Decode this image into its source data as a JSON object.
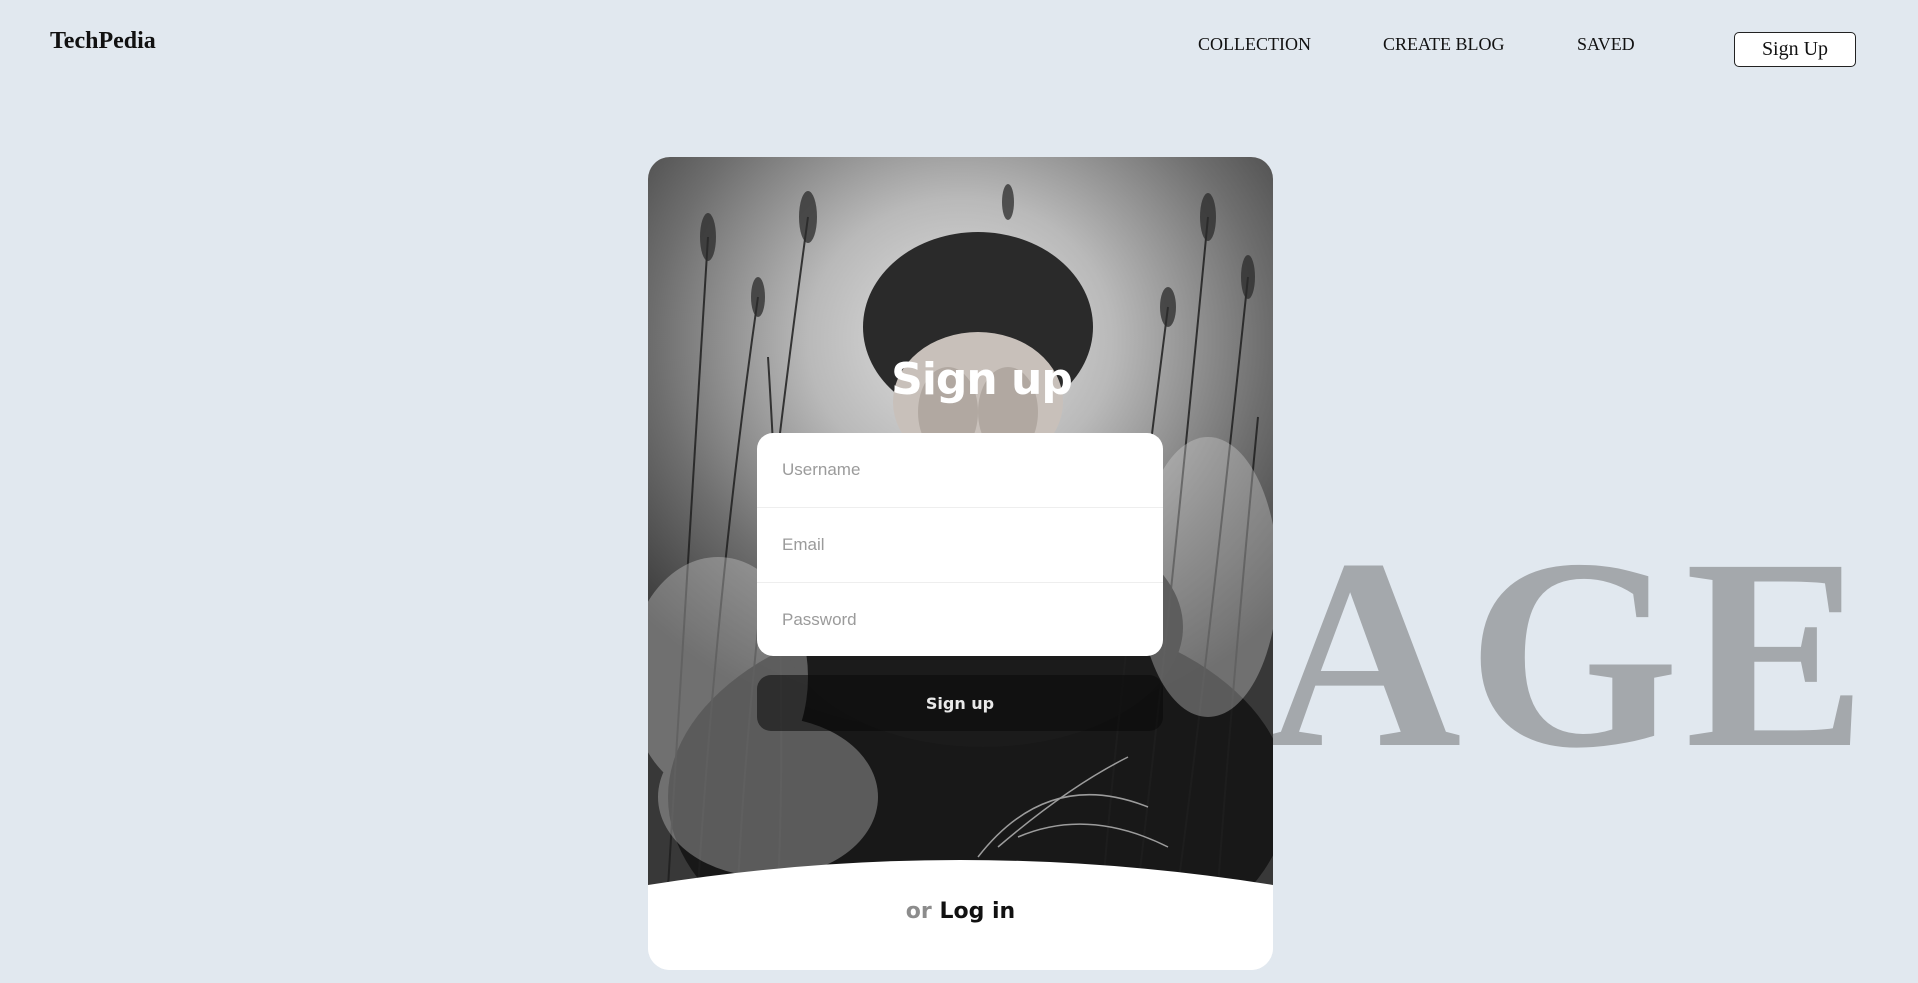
{
  "brand": "TechPedia",
  "nav": {
    "collection": "COLLECTION",
    "create_blog": "CREATE BLOG",
    "saved": "SAVED",
    "signup": "Sign Up"
  },
  "background_text": "AGE",
  "card": {
    "title": "Sign up",
    "fields": {
      "username_placeholder": "Username",
      "email_placeholder": "Email",
      "password_placeholder": "Password"
    },
    "submit_label": "Sign up",
    "alt_prefix": "or",
    "alt_link": "Log in"
  },
  "colors": {
    "page_background": "#e1e8ef",
    "background_text": "#a4a8ac"
  }
}
